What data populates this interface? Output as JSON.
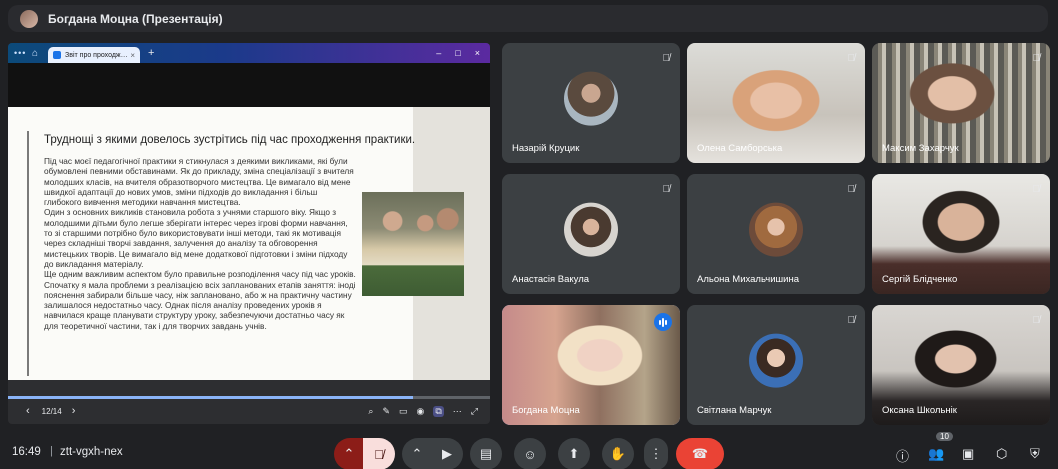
{
  "top": {
    "title": "Богдана Моцна (Презентація)"
  },
  "presentation": {
    "browser_tab": "Звіт про проходж…",
    "slide_title": "Труднощі з якими довелось зустрітись під час проходження практики.",
    "slide_body": "Під час моєї педагогічної практики я стикнулася з деякими викликами, які були обумовлені певними обставинами. Як до прикладу, зміна спеціалізації з вчителя молодших класів, на вчителя образотворчого мистецтва. Це вимагало від мене швидкої адаптації до нових умов, зміни підходів до викладання і більш глибокого вивчення методики навчання мистецтва.\nОдин з основних викликів становила робота з учнями старшого віку. Якщо з молодшими дітьми було легше зберігати інтерес через ігрові форми навчання, то зі старшими потрібно було використовувати інші методи, такі як мотивація через складніші творчі завдання, залучення до аналізу та обговорення мистецьких творів. Це вимагало від мене додаткової підготовки і зміни підходу до викладання матеріалу.\nЩе одним важливим аспектом було правильне розподілення часу під час уроків. Спочатку я мала проблеми з реалізацією всіх запланованих етапів заняття: іноді пояснення забирали більше часу, ніж заплановано, або ж на практичну частину залишалося недостатньо часу. Однак після аналізу проведених уроків я навчилася краще планувати структуру уроку, забезпечуючи достатньо часу як для теоретичної частини, так і для творчих завдань учнів.",
    "page_indicator": "12/14",
    "progress": 0.84
  },
  "participants": [
    {
      "name": "Назарій Круцик",
      "kind": "avatar",
      "muted": true
    },
    {
      "name": "Олена Самборська",
      "kind": "video",
      "muted": true
    },
    {
      "name": "Максим Захарчук",
      "kind": "video",
      "muted": true
    },
    {
      "name": "Анастасія Вакула",
      "kind": "avatar",
      "muted": true
    },
    {
      "name": "Альона Михальчишина",
      "kind": "avatar",
      "muted": true
    },
    {
      "name": "Сергій Блідченко",
      "kind": "video",
      "muted": true
    },
    {
      "name": "Богдана Моцна",
      "kind": "video",
      "speaking": true
    },
    {
      "name": "Світлана Марчук",
      "kind": "avatar",
      "muted": true
    },
    {
      "name": "Оксана Школьнік",
      "kind": "video",
      "muted": true
    }
  ],
  "bottom": {
    "time": "16:49",
    "separator": "|",
    "meeting_code": "ztt-vgxh-nex",
    "people_count": "10"
  },
  "colors": {
    "accent": "#8ab4f8",
    "hangup": "#ea4335",
    "tile": "#3c4043"
  }
}
